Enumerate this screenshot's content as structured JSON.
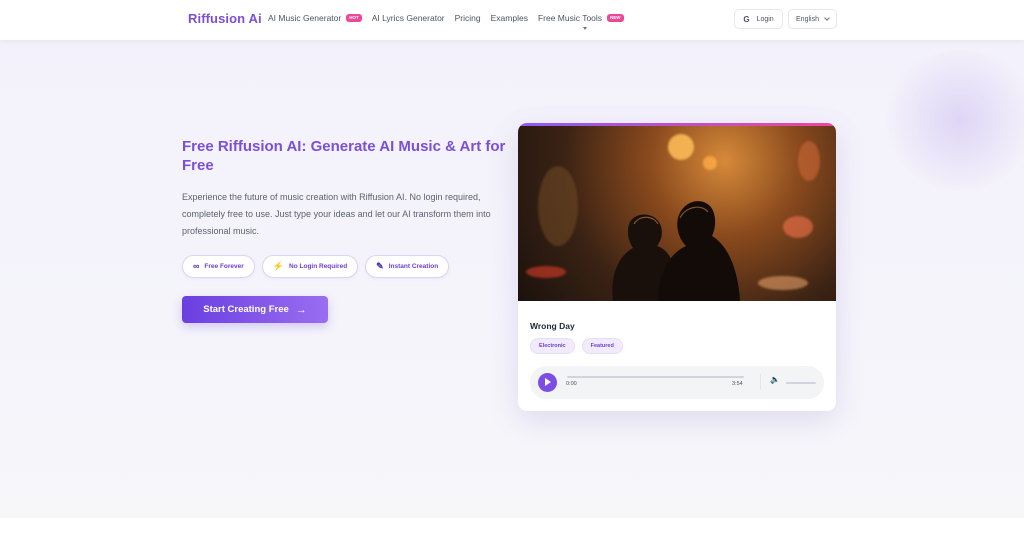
{
  "header": {
    "logo": "Riffusion Ai",
    "nav": [
      {
        "label": "AI Music Generator",
        "badge": "HOT"
      },
      {
        "label": "AI Lyrics Generator"
      },
      {
        "label": "Pricing"
      },
      {
        "label": "Examples"
      },
      {
        "label": "Free Music Tools",
        "badge": "NEW",
        "icon": "chevron-down-icon"
      }
    ],
    "login": {
      "icon": "G",
      "label": "Login"
    },
    "language": {
      "label": "English",
      "icon": "chevron-down-icon"
    }
  },
  "hero": {
    "title": "Free Riffusion AI: Generate AI Music & Art for Free",
    "description": "Experience the future of music creation with Riffusion AI. No login required, completely free to use. Just type your ideas and let our AI transform them into professional music.",
    "features": [
      {
        "icon": "∞",
        "icon_name": "infinity-icon",
        "label": "Free Forever"
      },
      {
        "icon": "⚡",
        "icon_name": "bolt-icon",
        "label": "No Login Required"
      },
      {
        "icon": "✎",
        "icon_name": "pencil-icon",
        "label": "Instant Creation"
      }
    ],
    "cta": {
      "label": "Start Creating Free",
      "icon": "→"
    }
  },
  "player": {
    "title": "Wrong Day",
    "tags": [
      "Electronic",
      "Featured"
    ],
    "current_time": "0:00",
    "duration": "3:54",
    "progress": 0,
    "volume_icon": "🔈"
  },
  "colors": {
    "brand": "#7b4fd6",
    "accent": "#ec4899",
    "cta_start": "#6a3fe0",
    "cta_end": "#9a6ef0"
  }
}
